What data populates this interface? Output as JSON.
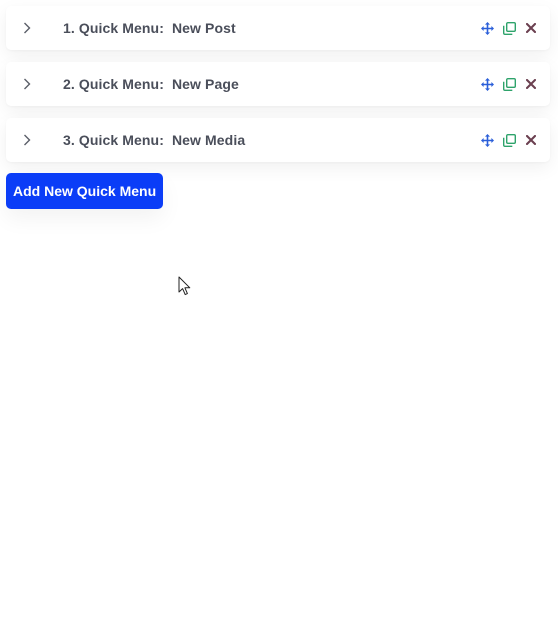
{
  "quick_menus": [
    {
      "number": "1.",
      "prefix": "Quick Menu:",
      "name": "New Post"
    },
    {
      "number": "2.",
      "prefix": "Quick Menu:",
      "name": "New Page"
    },
    {
      "number": "3.",
      "prefix": "Quick Menu:",
      "name": "New Media"
    }
  ],
  "add_button_label": "Add New Quick Menu",
  "icons": {
    "expand": "chevron-right-icon",
    "move": "move-arrows-icon",
    "duplicate": "duplicate-icon",
    "delete": "close-icon"
  },
  "colors": {
    "primary": "#0b3df7",
    "move_icon": "#2b5fd9",
    "duplicate_icon": "#2ea36b",
    "delete_icon": "#6b4050",
    "label_text": "#4a4e5a"
  }
}
